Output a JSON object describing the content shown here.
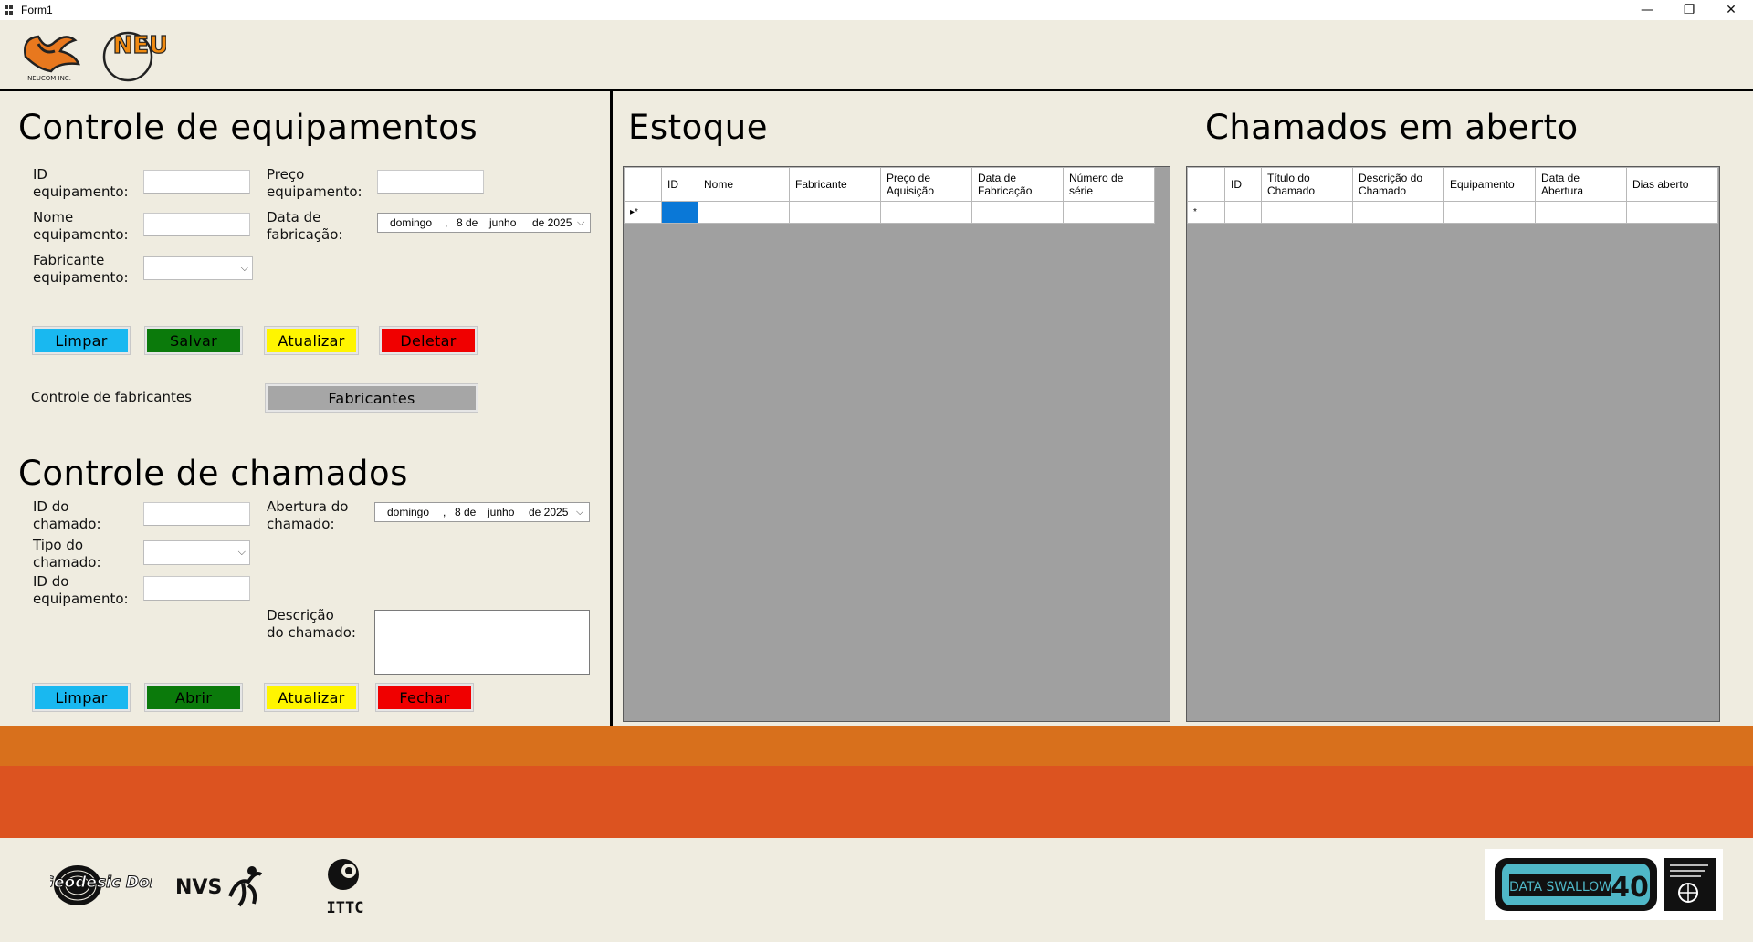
{
  "window": {
    "title": "Form1",
    "minimize_glyph": "—",
    "restore_glyph": "❐",
    "close_glyph": "✕"
  },
  "logos": {
    "top_left_caption": "NEUCOM INC.",
    "top_second_text": "NEU",
    "bottom_geodesic": "Geodesic Dome",
    "bottom_nvs": "NVS",
    "bottom_ittc": "ITTC",
    "bottom_right_text": "DATA SWALLOW",
    "bottom_right_number": "40"
  },
  "equipamentos": {
    "title": "Controle de equipamentos",
    "id_label": "ID\nequipamento:",
    "id_value": "",
    "preco_label": "Preço\nequipamento:",
    "preco_value": "",
    "nome_label": "Nome\nequipamento:",
    "nome_value": "",
    "data_label": "Data de\nfabricação:",
    "data_weekday": "domingo",
    "data_sep": ",",
    "data_day": "8 de",
    "data_month": "junho",
    "data_year": "de 2025",
    "fabricante_label": "Fabricante\nequipamento:",
    "fabricante_value": "",
    "btn_limpar": "Limpar",
    "btn_salvar": "Salvar",
    "btn_atualizar": "Atualizar",
    "btn_deletar": "Deletar",
    "fabricantes_label": "Controle de fabricantes",
    "btn_fabricantes": "Fabricantes"
  },
  "chamados": {
    "title": "Controle de chamados",
    "id_label": "ID do\nchamado:",
    "id_value": "",
    "abertura_label": "Abertura do\nchamado:",
    "abertura_weekday": "domingo",
    "abertura_sep": ",",
    "abertura_day": "8 de",
    "abertura_month": "junho",
    "abertura_year": "de 2025",
    "tipo_label": "Tipo do\nchamado:",
    "tipo_value": "",
    "id_equip_label": "ID do\nequipamento:",
    "id_equip_value": "",
    "descricao_label": "Descrição\ndo chamado:",
    "descricao_value": "",
    "btn_limpar": "Limpar",
    "btn_abrir": "Abrir",
    "btn_atualizar": "Atualizar",
    "btn_fechar": "Fechar"
  },
  "estoque": {
    "title": "Estoque",
    "row_indicator": "▸*",
    "columns": [
      "ID",
      "Nome",
      "Fabricante",
      "Preço de Aquisição",
      "Data de Fabricação",
      "Número de série"
    ]
  },
  "chamados_aberto": {
    "title": "Chamados em aberto",
    "row_indicator": "*",
    "columns": [
      "ID",
      "Título do Chamado",
      "Descrição do Chamado",
      "Equipamento",
      "Data de Abertura",
      "Dias aberto"
    ]
  },
  "colors": {
    "background": "#efece0",
    "limpar": "#19b8f0",
    "salvar": "#0b7a0b",
    "atualizar": "#fff500",
    "deletar": "#f00000",
    "fabricantes": "#a6a6a6",
    "grid_bg": "#a0a0a0",
    "selected_cell": "#0a78d7",
    "band_top": "#d8701c",
    "band_bottom": "#dc5320"
  }
}
